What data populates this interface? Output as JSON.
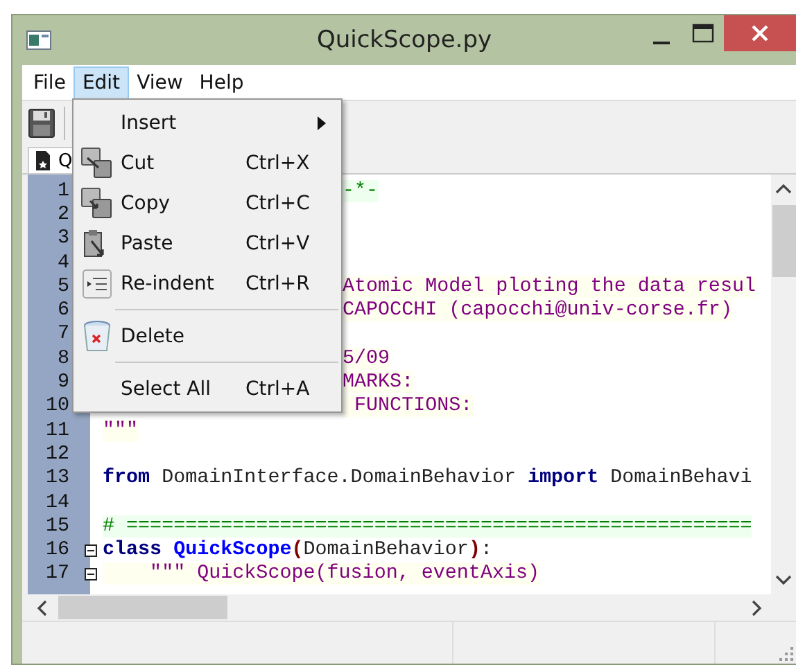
{
  "window": {
    "title": "QuickScope.py"
  },
  "menu_bar": [
    {
      "label": "File",
      "selected": false
    },
    {
      "label": "Edit",
      "selected": true
    },
    {
      "label": "View",
      "selected": false
    },
    {
      "label": "Help",
      "selected": false
    }
  ],
  "tab": {
    "label": "Q"
  },
  "edit_menu": [
    {
      "kind": "submenu",
      "label": "Insert"
    },
    {
      "kind": "item",
      "label": "Cut",
      "shortcut": "Ctrl+X"
    },
    {
      "kind": "item",
      "label": "Copy",
      "shortcut": "Ctrl+C"
    },
    {
      "kind": "item",
      "label": "Paste",
      "shortcut": "Ctrl+V"
    },
    {
      "kind": "item",
      "label": "Re-indent",
      "shortcut": "Ctrl+R"
    },
    {
      "kind": "separator"
    },
    {
      "kind": "item",
      "label": "Delete"
    },
    {
      "kind": "separator"
    },
    {
      "kind": "item",
      "label": "Select All",
      "shortcut": "Ctrl+A"
    }
  ],
  "code_lines": [
    {
      "number": "1",
      "segments": [
        {
          "kind": "comment",
          "text": "-*-"
        }
      ]
    },
    {
      "number": "2"
    },
    {
      "number": "3"
    },
    {
      "number": "4"
    },
    {
      "number": "5",
      "segments": [
        {
          "kind": "string",
          "text": "Atomic Model ploting the data resul"
        }
      ]
    },
    {
      "number": "6",
      "segments": [
        {
          "kind": "string",
          "text": "CAPOCCHI (capocchi@univ-corse.fr)"
        }
      ]
    },
    {
      "number": "7"
    },
    {
      "number": "8",
      "segments": [
        {
          "kind": "string",
          "text": "5/09"
        }
      ]
    },
    {
      "number": "9",
      "segments": [
        {
          "kind": "string",
          "text": "MARKS:"
        }
      ]
    },
    {
      "number": "10",
      "segments": [
        {
          "kind": "string",
          "text": " FUNCTIONS:"
        }
      ]
    },
    {
      "number": "11",
      "segments": [
        {
          "kind": "string",
          "text": "\"\"\""
        }
      ]
    },
    {
      "number": "12"
    },
    {
      "number": "13",
      "segments": [
        {
          "kind": "keyword",
          "text": "from"
        },
        {
          "kind": "plain",
          "text": " DomainInterface.DomainBehavior "
        },
        {
          "kind": "keyword",
          "text": "import"
        },
        {
          "kind": "plain",
          "text": " DomainBehavi"
        }
      ]
    },
    {
      "number": "14"
    },
    {
      "number": "15",
      "segments": [
        {
          "kind": "comment",
          "text": "# ====================================================="
        }
      ]
    },
    {
      "number": "16",
      "fold": true,
      "segments": [
        {
          "kind": "keyword",
          "text": "class "
        },
        {
          "kind": "classname",
          "text": "QuickScope"
        },
        {
          "kind": "operator",
          "text": "("
        },
        {
          "kind": "plain",
          "text": "DomainBehavior"
        },
        {
          "kind": "operator",
          "text": ")"
        },
        {
          "kind": "plain",
          "text": ":"
        }
      ]
    },
    {
      "number": "17",
      "fold": true,
      "segments": [
        {
          "kind": "string",
          "text": "    \"\"\" QuickScope(fusion, eventAxis)"
        }
      ]
    }
  ]
}
